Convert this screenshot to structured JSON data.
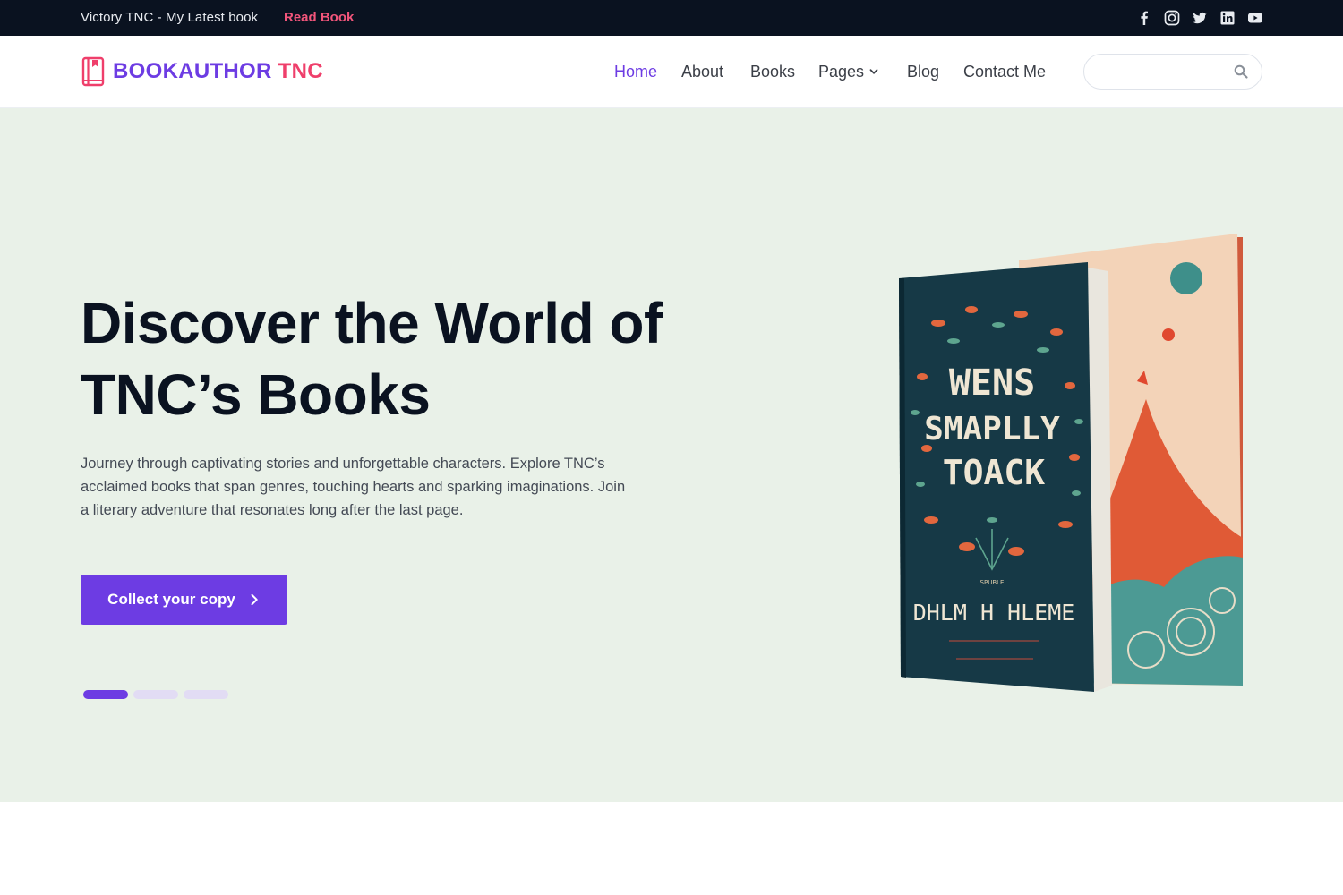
{
  "topbar": {
    "announcement": "Victory TNC - My Latest book",
    "read_link": "Read Book",
    "social_icons": [
      "facebook-icon",
      "instagram-icon",
      "twitter-icon",
      "linkedin-icon",
      "youtube-icon"
    ]
  },
  "header": {
    "logo_part1": "BOOKAUTHOR",
    "logo_part2": "TNC",
    "nav": {
      "home": "Home",
      "about": "About",
      "books": "Books",
      "pages": "Pages",
      "blog": "Blog",
      "contact": "Contact Me"
    },
    "search": {
      "placeholder": "",
      "value": ""
    }
  },
  "hero": {
    "title_line1": "Discover the World of",
    "title_line2": "TNC’s Books",
    "description": "Journey through captivating stories and unforgettable characters. Explore TNC’s acclaimed books that span genres, touching hearts and sparking imaginations. Join a literary adventure that resonates long after the last page.",
    "cta_label": "Collect your copy",
    "slider": {
      "slide_count": 3,
      "active_index": 0
    },
    "book_cover": {
      "title_line1": "WENS",
      "title_line2": "SMAPLLY",
      "title_line3": "TOACK",
      "small_label": "SPUBLE",
      "author": "DHLM H HLEME"
    }
  },
  "colors": {
    "accent": "#6d3ce3",
    "brand_pink": "#ef3f6b",
    "topbar_bg": "#0a1220",
    "hero_bg": "#e9f1e8"
  }
}
